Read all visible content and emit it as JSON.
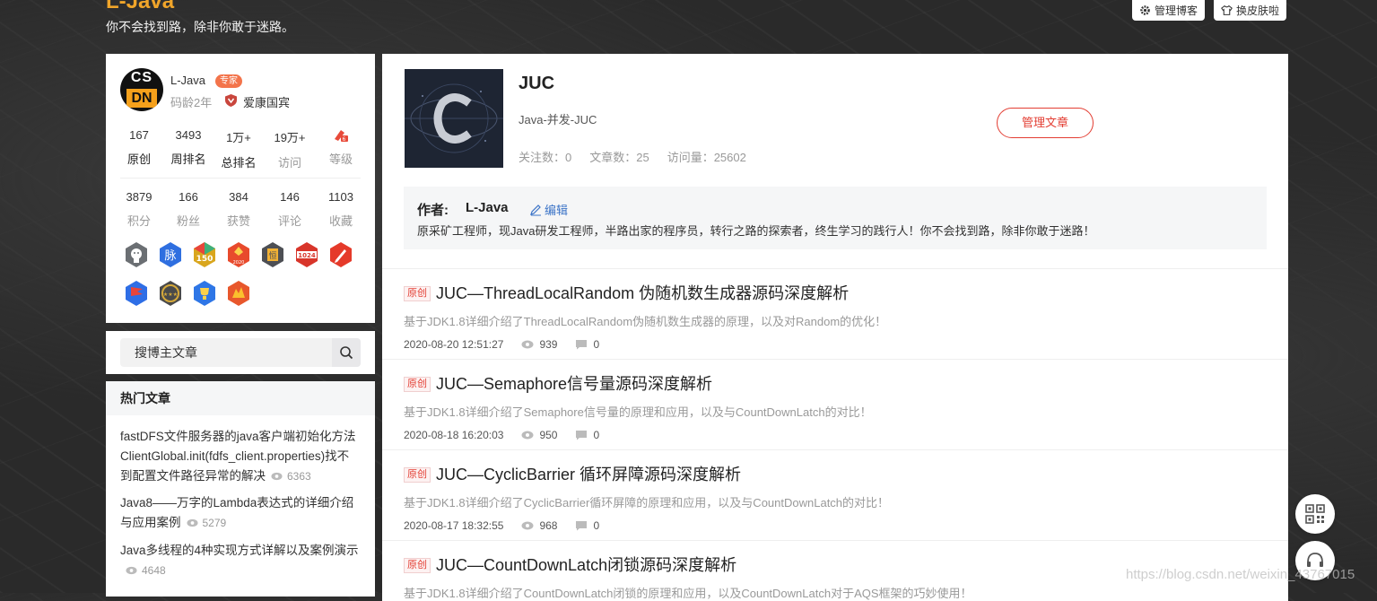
{
  "header": {
    "blog_title": "L-Java",
    "motto": "你不会找到路，除非你敢于迷路。",
    "manage_blog": "管理博客",
    "change_skin": "换皮肤啦"
  },
  "profile": {
    "avatar_top": "CS",
    "avatar_bottom": "DN",
    "username": "L-Java",
    "expert_badge": "专家",
    "code_age": "码龄2年",
    "vip_label": "爱康国宾",
    "stats_row1": [
      {
        "num": "167",
        "label": "原创"
      },
      {
        "num": "3493",
        "label": "周排名"
      },
      {
        "num": "1万+",
        "label": "总排名"
      },
      {
        "num": "19万+",
        "label": "访问"
      },
      {
        "num": "",
        "label": "等级"
      }
    ],
    "stats_row2": [
      {
        "num": "3879",
        "label": "积分"
      },
      {
        "num": "166",
        "label": "粉丝"
      },
      {
        "num": "384",
        "label": "获赞"
      },
      {
        "num": "146",
        "label": "评论"
      },
      {
        "num": "1103",
        "label": "收藏"
      }
    ],
    "badges_row1": [
      {
        "icon": "github-badge",
        "text": "",
        "color": "#6b6f73"
      },
      {
        "icon": "mai-badge",
        "text": "脉",
        "color": "#2f6fe0"
      },
      {
        "icon": "150-badge",
        "text": "150",
        "color": "#d9a61d"
      },
      {
        "icon": "2020-badge",
        "text": "2020",
        "color": "#e84a2c"
      },
      {
        "icon": "hang-badge",
        "text": "恒",
        "color": "#4d4f54"
      },
      {
        "icon": "1024-badge",
        "text": "1024",
        "color": "#d8352a"
      },
      {
        "icon": "pen-badge",
        "text": "",
        "color": "#e53a2a"
      }
    ],
    "badges_row2": [
      {
        "icon": "flag-badge",
        "text": "",
        "color": "#2e6ee6"
      },
      {
        "icon": "star-badge",
        "text": "",
        "color": "#5a5a5a"
      },
      {
        "icon": "cup-badge",
        "text": "",
        "color": "#2e76e6"
      },
      {
        "icon": "fire-badge",
        "text": "",
        "color": "#e8572c"
      }
    ]
  },
  "search": {
    "placeholder": "搜博主文章"
  },
  "hot": {
    "title": "热门文章",
    "items": [
      {
        "title": "fastDFS文件服务器的java客户端初始化方法ClientGlobal.init(fdfs_client.properties)找不到配置文件路径异常的解决",
        "views": "6363"
      },
      {
        "title": "Java8——万字的Lambda表达式的详细介绍与应用案例",
        "views": "5279"
      },
      {
        "title": "Java多线程的4种实现方式详解以及案例演示",
        "views": "4648"
      }
    ]
  },
  "column": {
    "title": "JUC",
    "desc": "Java-并发-JUC",
    "followers": "关注数：0",
    "articles": "文章数：25",
    "visits": "访问量：25602",
    "manage_btn": "管理文章"
  },
  "author": {
    "label": "作者:",
    "name": "L-Java",
    "edit": "编辑",
    "intro": "原采矿工程师，现Java研发工程师，半路出家的程序员，转行之路的探索者，终生学习的践行人！你不会找到路，除非你敢于迷路！"
  },
  "articles": [
    {
      "tag": "原创",
      "title": "JUC—ThreadLocalRandom 伪随机数生成器源码深度解析",
      "summary": "基于JDK1.8详细介绍了ThreadLocalRandom伪随机数生成器的原理，以及对Random的优化！",
      "date": "2020-08-20 12:51:27",
      "views": "939",
      "comments": "0"
    },
    {
      "tag": "原创",
      "title": "JUC—Semaphore信号量源码深度解析",
      "summary": "基于JDK1.8详细介绍了Semaphore信号量的原理和应用，以及与CountDownLatch的对比！",
      "date": "2020-08-18 16:20:03",
      "views": "950",
      "comments": "0"
    },
    {
      "tag": "原创",
      "title": "JUC—CyclicBarrier 循环屏障源码深度解析",
      "summary": "基于JDK1.8详细介绍了CyclicBarrier循环屏障的原理和应用，以及与CountDownLatch的对比！",
      "date": "2020-08-17 18:32:55",
      "views": "968",
      "comments": "0"
    },
    {
      "tag": "原创",
      "title": "JUC—CountDownLatch闭锁源码深度解析",
      "summary": "基于JDK1.8详细介绍了CountDownLatch闭锁的原理和应用，以及CountDownLatch对于AQS框架的巧妙使用！",
      "date": "",
      "views": "",
      "comments": ""
    }
  ],
  "watermark": "https://blog.csdn.net/weixin_43767015"
}
